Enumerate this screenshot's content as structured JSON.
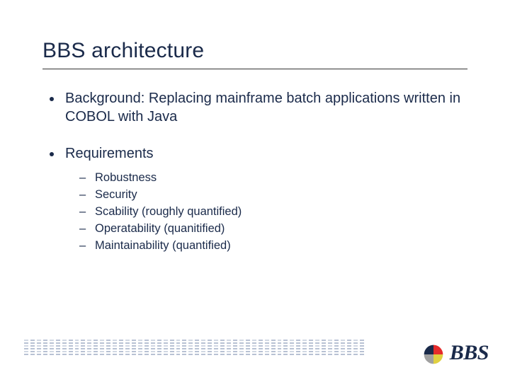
{
  "title": "BBS architecture",
  "bullets": [
    {
      "text": "Background: Replacing mainframe batch applications written in COBOL with Java",
      "sub": []
    },
    {
      "text": "Requirements",
      "sub": [
        "Robustness",
        "Security",
        "Scability (roughly quantified)",
        "Operatability (quanitified)",
        "Maintainability (quantified)"
      ]
    }
  ],
  "logo_text": "BBS"
}
